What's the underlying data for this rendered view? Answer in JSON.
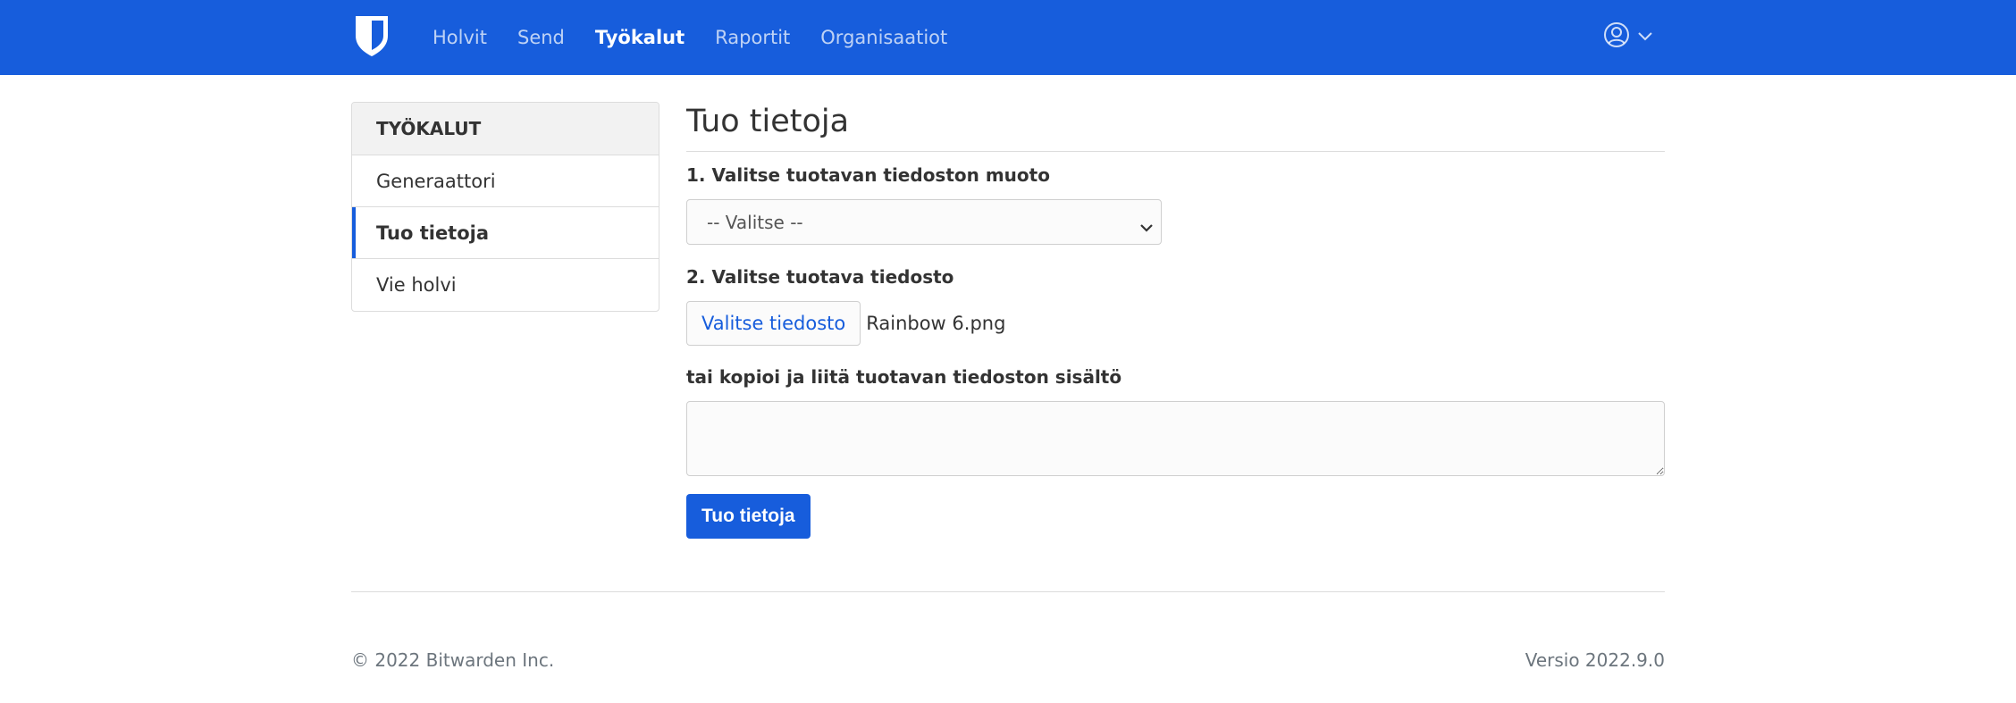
{
  "header": {
    "nav": [
      {
        "label": "Holvit",
        "active": false
      },
      {
        "label": "Send",
        "active": false
      },
      {
        "label": "Työkalut",
        "active": true
      },
      {
        "label": "Raportit",
        "active": false
      },
      {
        "label": "Organisaatiot",
        "active": false
      }
    ],
    "brand_icon": "shield-icon",
    "account_icon": "user-circle-icon",
    "account_caret_icon": "caret-down-icon"
  },
  "sidebar": {
    "title": "TYÖKALUT",
    "items": [
      {
        "label": "Generaattori",
        "active": false
      },
      {
        "label": "Tuo tietoja",
        "active": true
      },
      {
        "label": "Vie holvi",
        "active": false
      }
    ]
  },
  "main": {
    "title": "Tuo tietoja",
    "step1_label": "1. Valitse tuotavan tiedoston muoto",
    "format_select_value": "-- Valitse --",
    "step2_label": "2. Valitse tuotava tiedosto",
    "file_button_label": "Valitse tiedosto",
    "file_name": "Rainbow 6.png",
    "paste_label": "tai kopioi ja liitä tuotavan tiedoston sisältö",
    "paste_value": "",
    "submit_label": "Tuo tietoja"
  },
  "footer": {
    "copyright": "© 2022 Bitwarden Inc.",
    "version": "Versio 2022.9.0"
  },
  "colors": {
    "brand": "#175ddc",
    "border": "#dcdcdc",
    "text": "#333333",
    "muted": "#6c757d"
  }
}
